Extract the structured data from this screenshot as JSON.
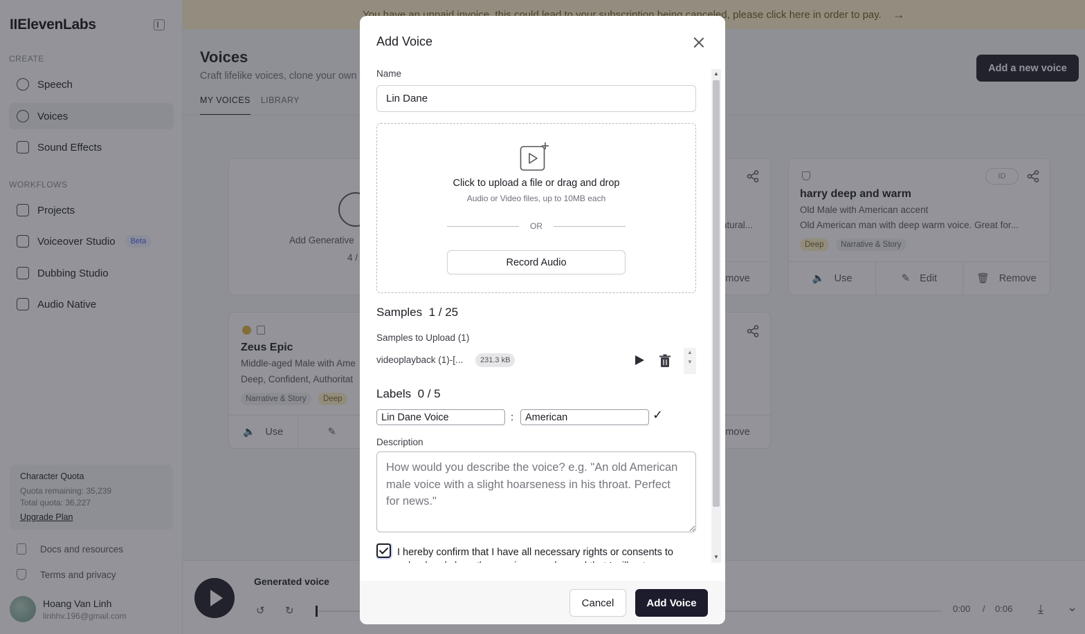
{
  "app": {
    "logo": "IIElevenLabs"
  },
  "sidebar": {
    "create_label": "CREATE",
    "workflows_label": "WORKFLOWS",
    "create_items": [
      {
        "label": "Speech",
        "icon": "speech-icon"
      },
      {
        "label": "Voices",
        "icon": "voices-icon",
        "active": true
      },
      {
        "label": "Sound Effects",
        "icon": "sound-effects-icon"
      }
    ],
    "workflow_items": [
      {
        "label": "Projects",
        "icon": "projects-icon"
      },
      {
        "label": "Voiceover Studio",
        "icon": "voiceover-icon",
        "badge": "Beta"
      },
      {
        "label": "Dubbing Studio",
        "icon": "dubbing-icon"
      },
      {
        "label": "Audio Native",
        "icon": "audio-native-icon"
      }
    ],
    "quota": {
      "title": "Character Quota",
      "remaining": "Quota remaining: 35,239",
      "total": "Total quota: 36,227",
      "upgrade": "Upgrade Plan"
    },
    "docs": "Docs and resources",
    "terms": "Terms and privacy",
    "user": {
      "name": "Hoang Van Linh",
      "email": "linhhv.196@gmail.com"
    }
  },
  "banner": {
    "text": "You have an unpaid invoice, this could lead to your subscription being canceled, please click here in order to pay.",
    "arrow": "→"
  },
  "page": {
    "title": "Voices",
    "subtitle": "Craft lifelike voices, clone your own",
    "tabs": [
      "MY VOICES",
      "LIBRARY"
    ],
    "add_voice_button": "Add a new voice"
  },
  "cards": {
    "generative": {
      "label": "Add Generative",
      "count": "4 /"
    },
    "harry": {
      "title": "harry deep and warm",
      "line1": "Old Male with American accent",
      "line2": "Old American man with deep warm voice. Great for...",
      "tags": [
        "Deep",
        "Narrative & Story"
      ],
      "id_badge": "ID",
      "actions": [
        "Use",
        "Edit",
        "Remove"
      ]
    },
    "zeus": {
      "title": "Zeus Epic",
      "line1": "Middle-aged Male with Ame",
      "line2": "Deep, Confident, Authoritat",
      "tags": [
        "Narrative & Story",
        "Deep"
      ],
      "use": "Use"
    },
    "partial_top": {
      "snippet": "atural...",
      "remove": "emove"
    },
    "partial_bottom": {
      "remove": "emove"
    }
  },
  "player": {
    "label": "Generated voice",
    "current": "0:00",
    "sep": "/",
    "total": "0:06"
  },
  "modal": {
    "title": "Add Voice",
    "name_label": "Name",
    "name_value": "Lin Dane",
    "upload_title": "Click to upload a file or drag and drop",
    "upload_sub": "Audio or Video files, up to 10MB each",
    "or": "OR",
    "record_button": "Record Audio",
    "samples_heading": "Samples",
    "samples_count": "1 / 25",
    "samples_to_upload": "Samples to Upload (1)",
    "sample": {
      "name": "videoplayback (1)-[...",
      "size": "231.3 kB"
    },
    "labels_heading": "Labels",
    "labels_count": "0 / 5",
    "label_key": "Lin Dane Voice",
    "label_value": "American",
    "colon": ":",
    "check": "✓",
    "description_label": "Description",
    "description_placeholder": "How would you describe the voice? e.g. \"An old American male voice with a slight hoarseness in his throat. Perfect for news.\"",
    "consent_text": "I hereby confirm that I have all necessary rights or consents to upload and clone these voice samples and that I will not use",
    "cancel_button": "Cancel",
    "submit_button": "Add Voice"
  }
}
